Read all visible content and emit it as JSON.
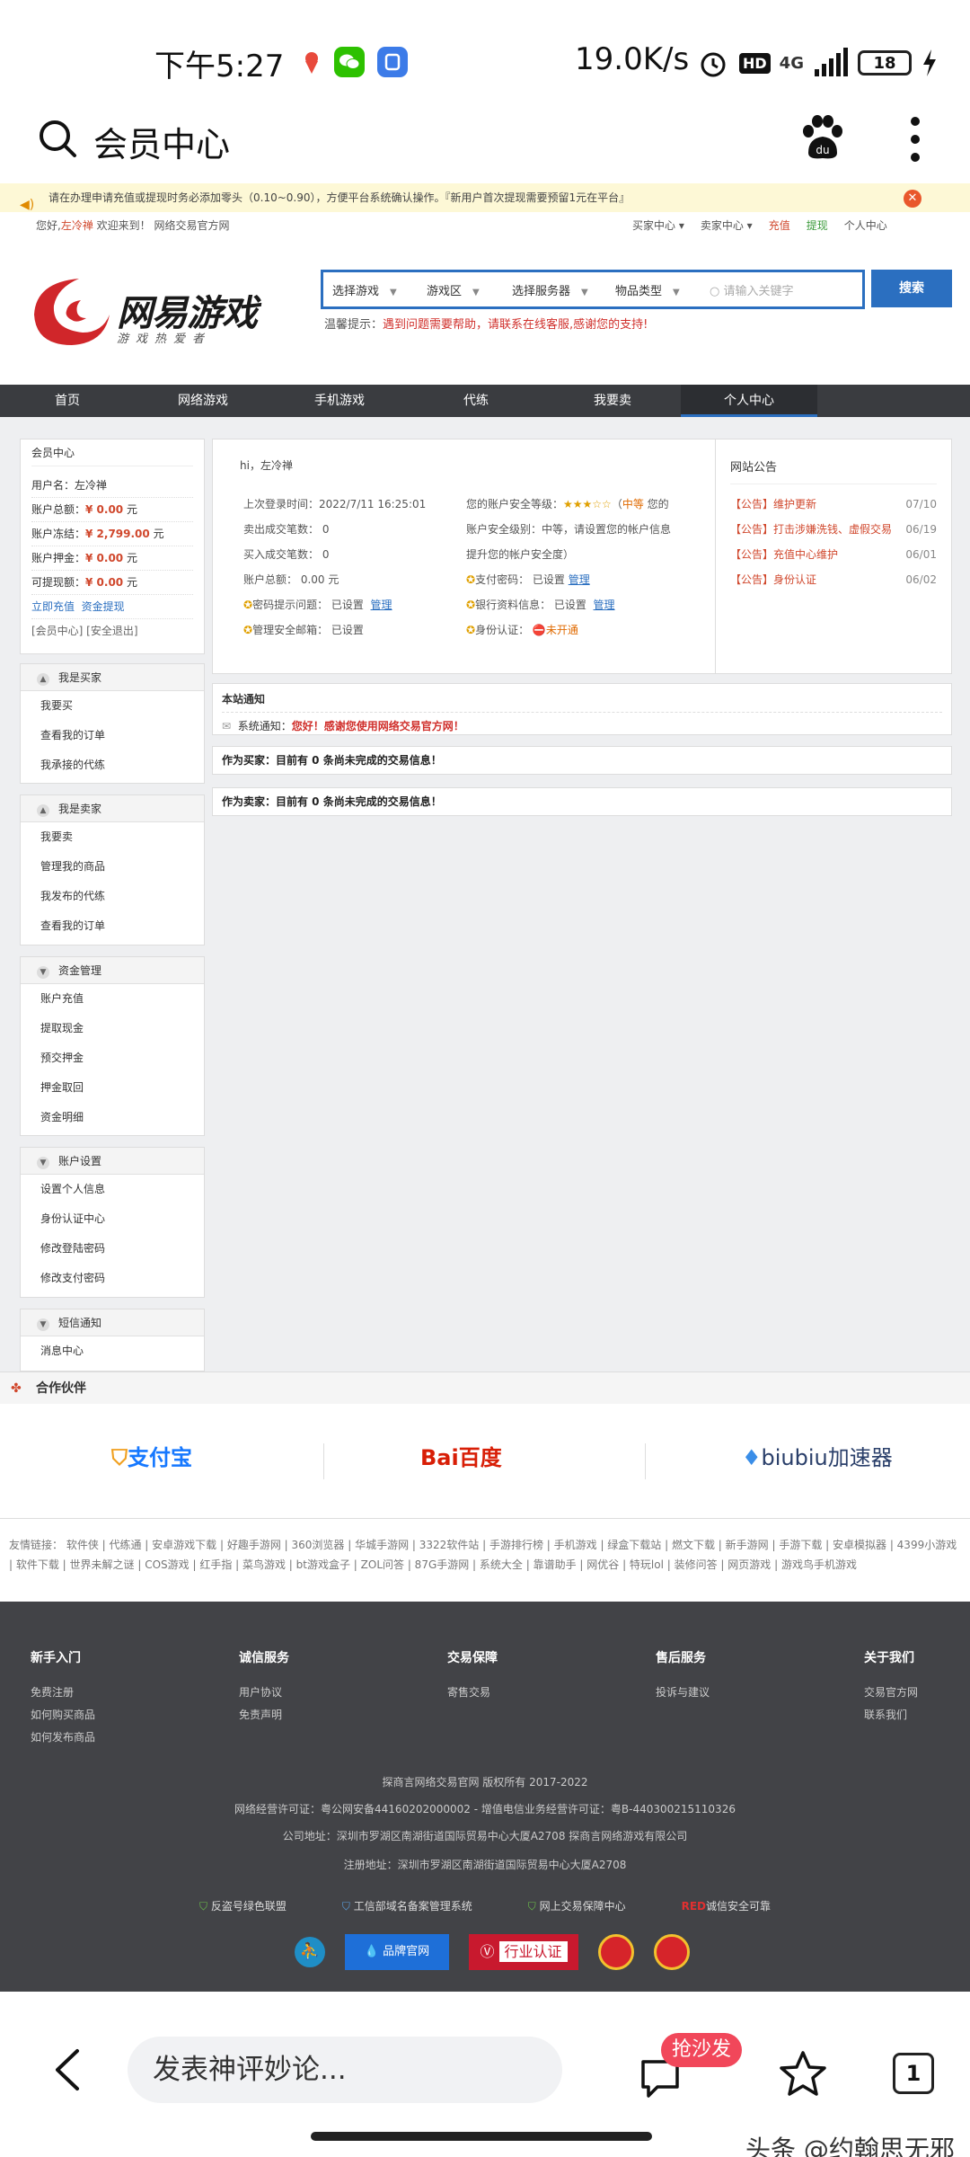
{
  "status_bar": {
    "time": "下午5:27",
    "speed": "19.0K/s",
    "net": "4G",
    "hd": "HD",
    "battery": "18"
  },
  "browser": {
    "title": "会员中心"
  },
  "notice_bar": {
    "text": "请在办理申请充值或提现时务必添加零头（0.10~0.90），方便平台系统确认操作。『新用户首次提现需要预留1元在平台』"
  },
  "top_links": {
    "greeting_prefix": "您好,",
    "username": "左冷禅",
    "greeting_suffix": " 欢迎来到！ 网络交易官方网",
    "right": [
      "买家中心 ▾",
      "卖家中心 ▾",
      "充值",
      "提现",
      "个人中心"
    ]
  },
  "header": {
    "logo_text": "网易游戏",
    "logo_sub": "游戏热爱者",
    "selects": [
      "选择游戏",
      "游戏区",
      "选择服务器",
      "物品类型"
    ],
    "keyword_placeholder": "请输入关键字",
    "search_label": "搜索",
    "tip_prefix": "温馨提示：",
    "tip_text": "遇到问题需要帮助，请联系在线客服,感谢您的支持!"
  },
  "nav": [
    "首页",
    "网络游戏",
    "手机游戏",
    "代练",
    "我要卖",
    "个人中心"
  ],
  "member": {
    "title": "会员中心",
    "username_label": "用户名：",
    "username": "左冷禅",
    "rows": [
      {
        "label": "账户总额：",
        "value": "¥ 0.00",
        "unit": " 元"
      },
      {
        "label": "账户冻结：",
        "value": "¥ 2,799.00",
        "unit": " 元"
      },
      {
        "label": "账户押金：",
        "value": "¥ 0.00",
        "unit": " 元"
      },
      {
        "label": "可提现额：",
        "value": "¥ 0.00",
        "unit": " 元"
      }
    ],
    "recharge": "立即充值",
    "withdraw": "资金提现",
    "links": "[会员中心] [安全退出]"
  },
  "menus": [
    {
      "title": "我是买家",
      "items": [
        "我要买",
        "查看我的订单",
        "我承接的代练"
      ]
    },
    {
      "title": "我是卖家",
      "items": [
        "我要卖",
        "管理我的商品",
        "我发布的代练",
        "查看我的订单"
      ]
    },
    {
      "title": "资金管理",
      "items": [
        "账户充值",
        "提取现金",
        "预交押金",
        "押金取回",
        "资金明细"
      ]
    },
    {
      "title": "账户设置",
      "items": [
        "设置个人信息",
        "身份认证中心",
        "修改登陆密码",
        "修改支付密码"
      ]
    },
    {
      "title": "短信通知",
      "items": [
        "消息中心"
      ]
    }
  ],
  "info": {
    "hi": "hi，左冷禅",
    "last_login_label": "上次登录时间：",
    "last_login": "2022/7/11 16:25:01",
    "sell_count": "卖出成交笔数：   0",
    "buy_count": "买入成交笔数：   0",
    "balance": "账户总额：  0.00 元",
    "pw_q": "密码提示问题：  已设置",
    "email": "管理安全邮箱：  已设置",
    "manage": "管理",
    "level_label": "您的账户安全等级：",
    "level_mid": "中等",
    "level_suffix": " 您的",
    "level_line2": "账户安全级别：中等，请设置您的帐户信息",
    "level_line3": "提升您的帐户安全度）",
    "pay_pw": "支付密码：  已设置",
    "bank": "银行资料信息：  已设置",
    "id_auth": "身份认证：",
    "id_status": "未开通"
  },
  "site_notices": {
    "title": "网站公告",
    "items": [
      {
        "text": "【公告】维护更新",
        "date": "07/10"
      },
      {
        "text": "【公告】打击涉嫌洗钱、虚假交易",
        "date": "06/19"
      },
      {
        "text": "【公告】充值中心维护",
        "date": "06/01"
      },
      {
        "text": "【公告】身份认证",
        "date": "06/02"
      }
    ]
  },
  "site_notice_box": {
    "title": "本站通知",
    "prefix": "系统通知：",
    "text": "您好！感谢您使用网络交易官方网！"
  },
  "trade_buyer": "作为买家：目前有 0 条尚未完成的交易信息！",
  "trade_seller": "作为卖家：目前有 0 条尚未完成的交易信息！",
  "partners": {
    "title": "合作伙伴",
    "items": [
      "支付宝",
      "Bai百度",
      "biubiu加速器"
    ]
  },
  "friends": "友情链接：  软件侠 | 代练通 | 安卓游戏下载 | 好趣手游网 | 360浏览器 | 华城手游网 | 3322软件站 | 手游排行榜 | 手机游戏 | 绿盒下载站 | 燃文下载 | 新手游网 | 手游下载 | 安卓模拟器 | 4399小游戏 | 软件下载 | 世界未解之谜 | COS游戏 | 红手指 | 菜鸟游戏 | bt游戏盒子 | ZOL问答 | 87G手游网 | 系统大全 | 靠谱助手 | 网优谷 | 特玩lol | 装修问答 | 网页游戏 | 游戏鸟手机游戏",
  "footer": {
    "cols": [
      {
        "title": "新手入门",
        "items": [
          "免费注册",
          "如何购买商品",
          "如何发布商品"
        ]
      },
      {
        "title": "诚信服务",
        "items": [
          "用户协议",
          "免责声明"
        ]
      },
      {
        "title": "交易保障",
        "items": [
          "寄售交易"
        ]
      },
      {
        "title": "售后服务",
        "items": [
          "投诉与建议"
        ]
      },
      {
        "title": "关于我们",
        "items": [
          "交易官方网",
          "联系我们"
        ]
      }
    ],
    "copyright": "探商言网络交易官网 版权所有 2017-2022",
    "license": "网络经营许可证：粤公网安备44160202000002 - 增值电信业务经营许可证：粤B-440300215110326",
    "address": "公司地址：深圳市罗湖区南湖街道国际贸易中心大厦A2708 探商言网络游戏有限公司",
    "reg_address": "注册地址：深圳市罗湖区南湖街道国际贸易中心大厦A2708",
    "badges": [
      "反盗号绿色联盟",
      "工信部域名备案管理系统",
      "网上交易保障中心",
      "诚信安全可靠"
    ],
    "badge_red": "RED",
    "brand": "品牌官网",
    "cert": "行业认证"
  },
  "bottom_bar": {
    "comment_placeholder": "发表神评妙论...",
    "badge": "抢沙发",
    "tabs": "1",
    "watermark": "头条 @约翰思无邪"
  }
}
